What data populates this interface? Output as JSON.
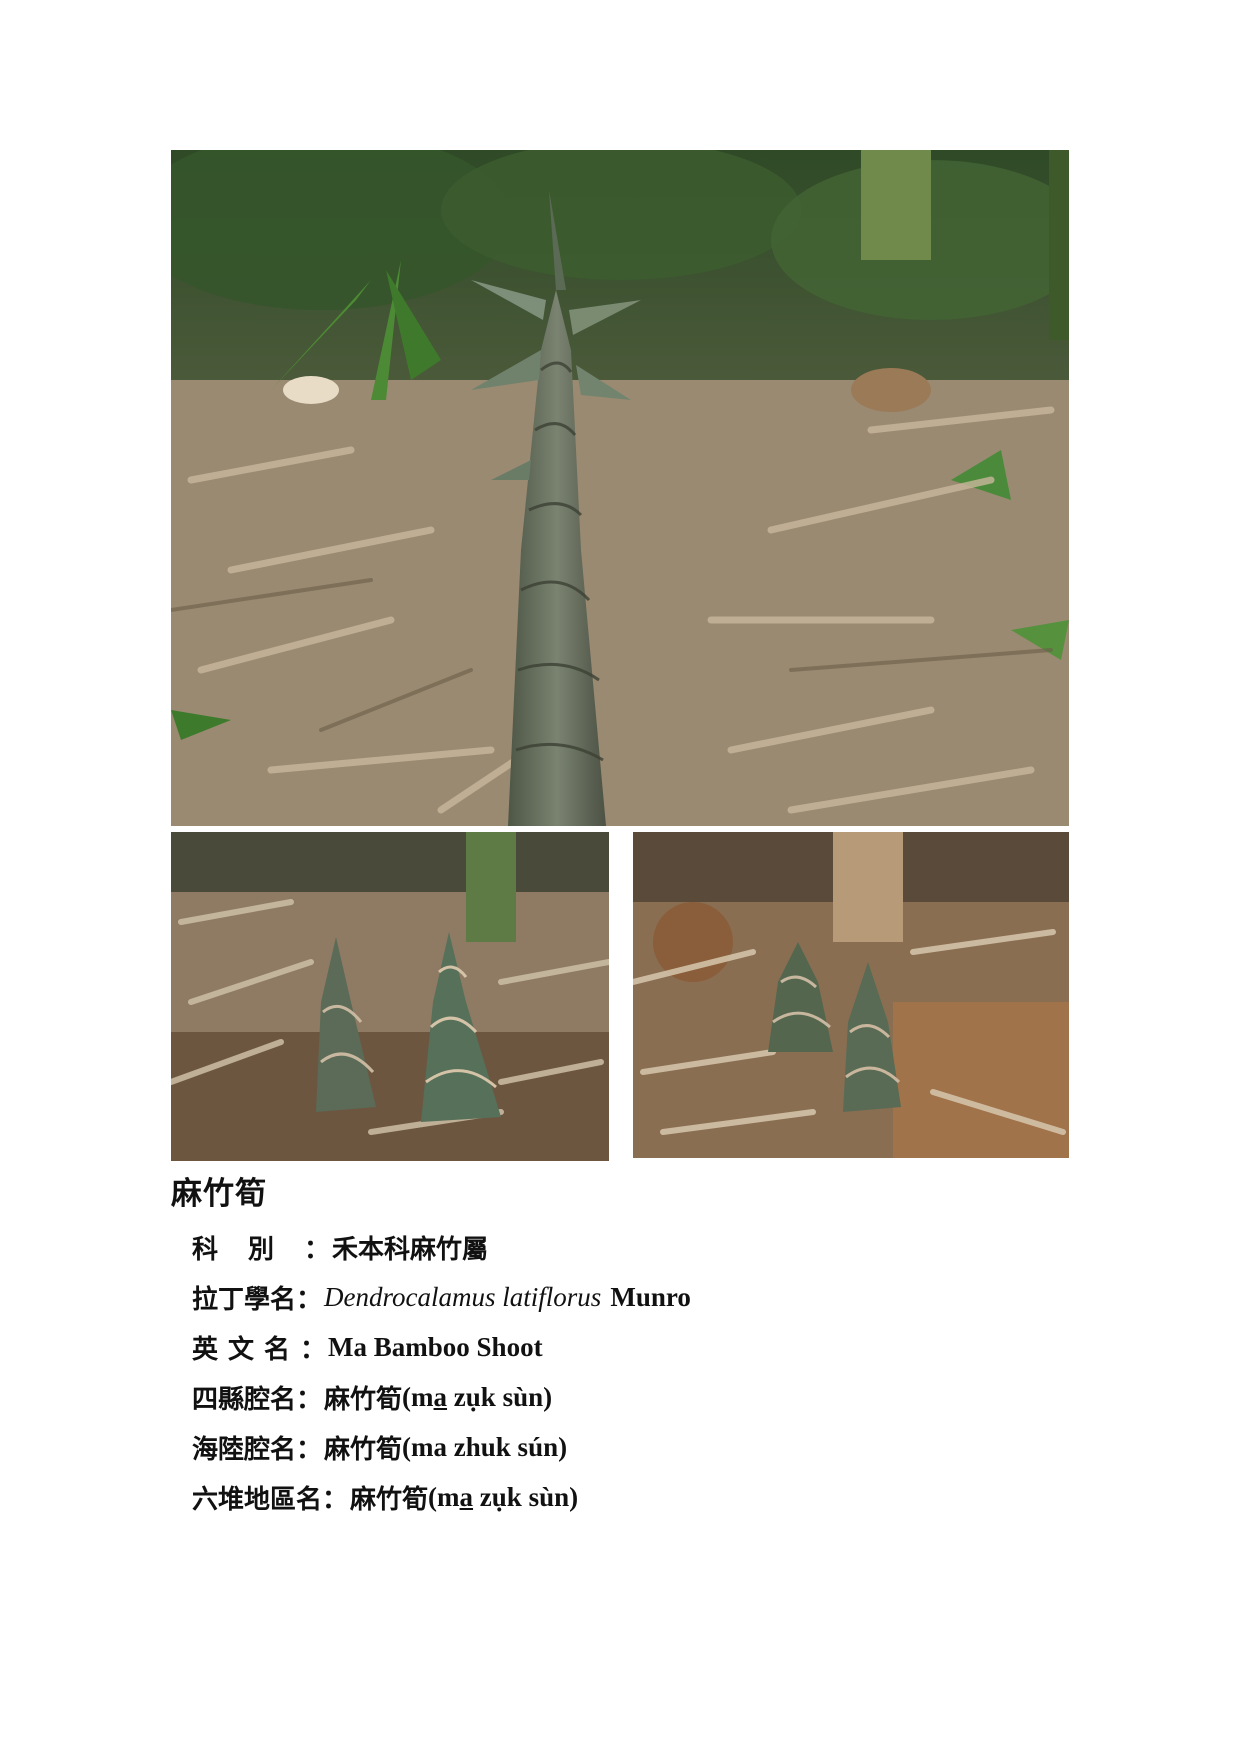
{
  "plant": {
    "name": "麻竹筍"
  },
  "fields": {
    "family": {
      "label": "科別",
      "colon": "：",
      "value": "禾本科麻竹屬"
    },
    "latin_name": {
      "label": "拉丁學名",
      "colon": "：",
      "genus_species": "Dendrocalamus latiflorus",
      "author": "Munro"
    },
    "english_name": {
      "label": "英文名",
      "colon": "：",
      "value": "Ma Bamboo Shoot"
    },
    "sixian_name": {
      "label": "四縣腔名",
      "colon": "：",
      "hanzi": "麻竹筍",
      "open": "(",
      "rom_1": "m",
      "rom_1_underlined": "a",
      "rom_2": " zụk sùn)"
    },
    "hailu_name": {
      "label": "海陸腔名",
      "colon": "：",
      "hanzi": "麻竹筍",
      "romanization": "(ma zhuk sún)"
    },
    "liudui_name": {
      "label": "六堆地區名",
      "colon": "：",
      "hanzi": "麻竹筍",
      "open": "(",
      "rom_1": "m",
      "rom_1_underlined": "a",
      "rom_2": " zụk sùn)"
    }
  },
  "colors": {
    "litter": "#9c8b73",
    "shoot_sheath": "#6f7560",
    "foliage": "#3f6e2e",
    "soil": "#7a5a3c"
  }
}
